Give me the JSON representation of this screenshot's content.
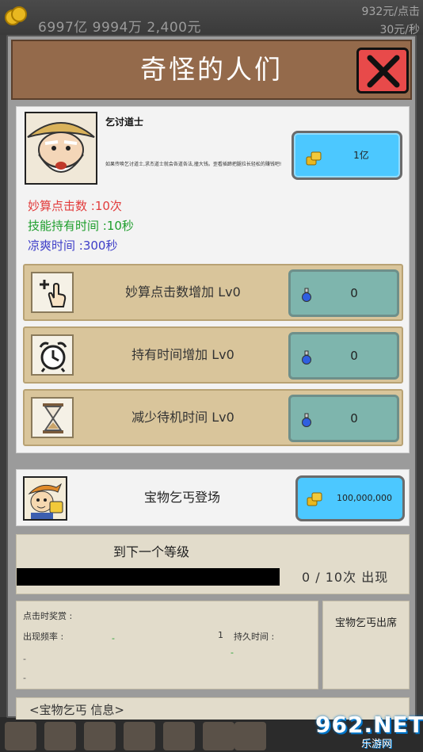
{
  "hud": {
    "money": "6997亿 9994万 2,400元",
    "per_click": "932元/点击",
    "per_second": "30元/秒"
  },
  "modal": {
    "title": "奇怪的人们",
    "close_icon": "close-x-icon"
  },
  "character": {
    "name": "乞讨道士",
    "description": "如果传唤乞讨道士,求杰道士就会各道各法,撞大钱。歪看插蹄把腿拉长轻松的赚钱吧!",
    "price": "1亿",
    "stats": {
      "clicks": "妙算点击数 :10次",
      "skill_time": "技能持有时间 :10秒",
      "cooldown": "凉爽时间 :300秒"
    }
  },
  "upgrades": [
    {
      "label": "妙算点击数增加 Lv0",
      "cost": "0",
      "icon": "tap-plus-icon"
    },
    {
      "label": "持有时间增加 Lv0",
      "cost": "0",
      "icon": "alarm-clock-icon"
    },
    {
      "label": "减少待机时间 Lv0",
      "cost": "0",
      "icon": "hourglass-icon"
    }
  ],
  "treasure": {
    "label": "宝物乞丐登场",
    "price": "100,000,000"
  },
  "level": {
    "title": "到下一个等级",
    "progress": 0,
    "count": "0 / 10次 出现"
  },
  "reward": {
    "click_reward_label": "点击时奖赏 :",
    "frequency_label": "出现频率 :",
    "frequency_value": "-",
    "number_value": "1",
    "duration_label": "持久时间 :",
    "duration_value": "-",
    "dash1": "-",
    "dash2": "-"
  },
  "exit_label": "宝物乞丐出席",
  "info_tab": "<宝物乞丐 信息>",
  "watermark": {
    "text": "962.NET",
    "sub": "乐游网"
  },
  "colors": {
    "header": "#946a4b",
    "close": "#e84a4a",
    "buy_button": "#4cc8ff",
    "upgrade_row": "#d9c59b",
    "upgrade_button": "#7eb5ad",
    "stat_red": "#e23c3c",
    "stat_green": "#1e9e2c",
    "stat_blue": "#3e3ec8"
  }
}
